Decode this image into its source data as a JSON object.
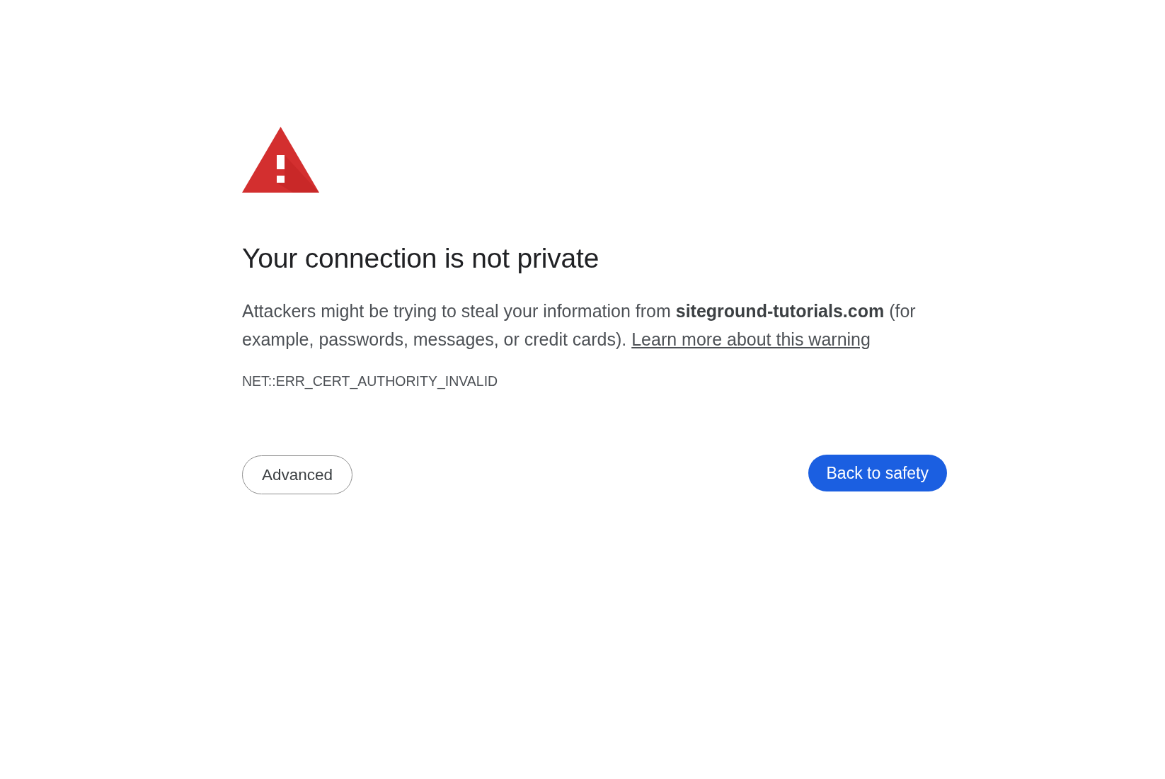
{
  "interstitial": {
    "title": "Your connection is not private",
    "message": "Attackers might be trying to steal your information from **siteground-tutorials.com** (for example, passwords, messages, or credit cards).",
    "learn_more_link": "Learn more about this warning",
    "error_code": "NET::ERR_CERT_AUTHORITY_INVALID",
    "buttons": [
      {
        "label": "Advanced",
        "kind": "secondary"
      },
      {
        "label": "Back to safety",
        "kind": "primary"
      }
    ]
  }
}
